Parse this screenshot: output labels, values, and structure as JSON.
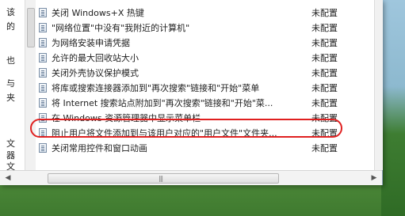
{
  "left_pane": {
    "fragments": [
      "该",
      "的",
      "也",
      "与",
      "夹",
      "文",
      "器",
      "文"
    ]
  },
  "policy_list": [
    {
      "name": "关闭 Windows+X 热键",
      "state": "未配置"
    },
    {
      "name": "\"网络位置\"中没有\"我附近的计算机\"",
      "state": "未配置"
    },
    {
      "name": "为网络安装申请凭据",
      "state": "未配置"
    },
    {
      "name": "允许的最大回收站大小",
      "state": "未配置"
    },
    {
      "name": "关闭外壳协议保护模式",
      "state": "未配置"
    },
    {
      "name": "将库或搜索连接器添加到\"再次搜索\"链接和\"开始\"菜单",
      "state": "未配置"
    },
    {
      "name": "将 Internet 搜索站点附加到\"再次搜索\"链接和\"开始\"菜...",
      "state": "未配置"
    },
    {
      "name": "在 Windows 资源管理器中显示菜单栏",
      "state": "未配置"
    },
    {
      "name": "阻止用户将文件添加到与该用户对应的\"用户文件\"文件夹...",
      "state": "未配置"
    },
    {
      "name": "关闭常用控件和窗口动画",
      "state": "未配置"
    }
  ],
  "hscroll": {
    "left_arrow": "◀",
    "right_arrow": "▶",
    "grip": "|||"
  },
  "colors": {
    "highlight": "#e02020"
  }
}
